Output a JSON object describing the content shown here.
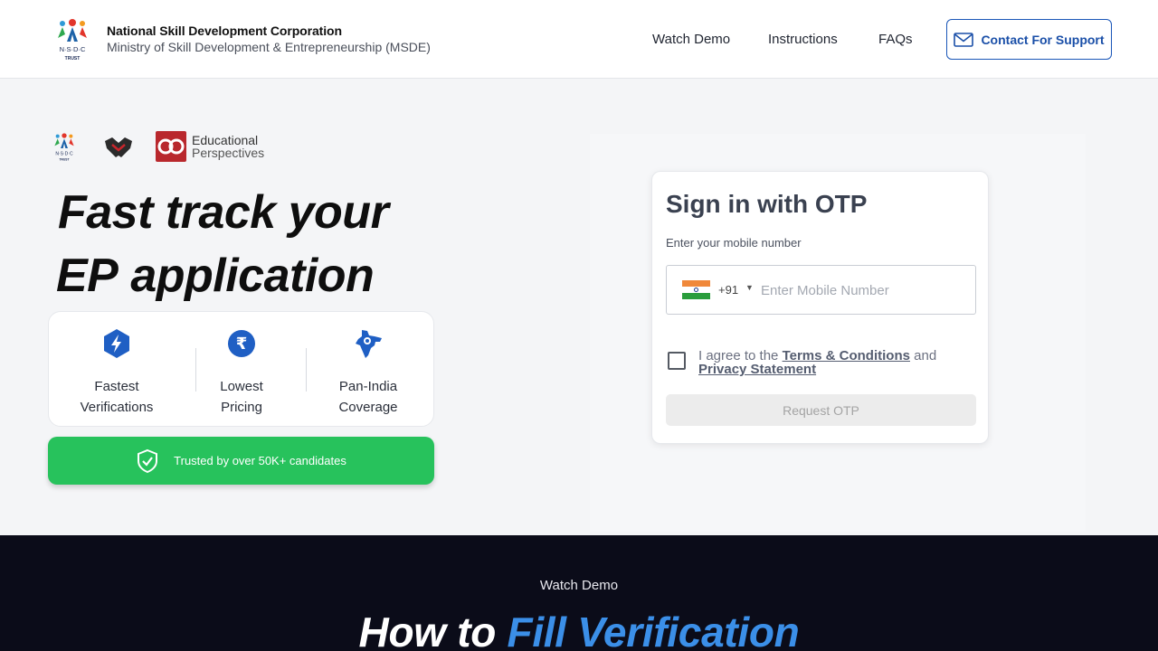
{
  "header": {
    "org_name": "National Skill Development Corporation",
    "org_sub": "Ministry of Skill Development & Entrepreneurship (MSDE)",
    "logo_letters": "N·S·D·C",
    "logo_trust": "TRUST",
    "nav": [
      "Watch Demo",
      "Instructions",
      "FAQs"
    ],
    "support_label": "Contact For Support"
  },
  "hero": {
    "partner_ep_1": "Educational",
    "partner_ep_2": "Perspectives",
    "headline_1": "Fast track your",
    "headline_ep": "EP",
    "headline_2": " application",
    "features": [
      {
        "line1": "Fastest",
        "line2": "Verifications",
        "icon": "bolt-shield-icon"
      },
      {
        "line1": "Lowest",
        "line2": "Pricing",
        "icon": "rupee-icon"
      },
      {
        "line1": "Pan-India",
        "line2": "Coverage",
        "icon": "india-map-icon"
      }
    ],
    "trusted": "Trusted by over 50K+ candidates"
  },
  "signin": {
    "title": "Sign in with OTP",
    "label": "Enter your mobile number",
    "country_code": "+91",
    "placeholder": "Enter Mobile Number",
    "agree_prefix": "I agree to the ",
    "terms": "Terms & Conditions",
    "agree_and": " and",
    "privacy": "Privacy Statement",
    "button": "Request OTP"
  },
  "demo": {
    "subtitle": "Watch Demo",
    "title_1": "How to ",
    "title_2": "Fill Verification"
  },
  "colors": {
    "brand_blue": "#1a4fa8",
    "trusted_green": "#27c25c",
    "dark_bg": "#0b0c19",
    "highlight_blue": "#3b8fe8"
  }
}
